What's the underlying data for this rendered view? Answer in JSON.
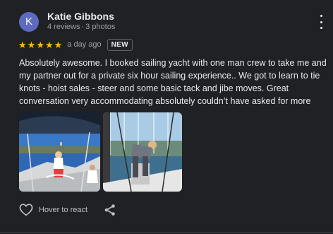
{
  "reviewer": {
    "initial": "K",
    "name": "Katie Gibbons",
    "reviews": "4 reviews",
    "photos": "3 photos",
    "separator": "·",
    "avatar_color": "#5c6bc0"
  },
  "rating": {
    "stars": 5,
    "star_glyph": "★",
    "star_color": "#fbbc04",
    "age": "a day ago",
    "badge": "NEW"
  },
  "review_text": "Absolutely awesome. I booked sailing yacht with one man crew to take me and my partner out for a private six hour sailing experience.. We got to learn to tie knots - hoist sales - steer and some basic tack and jibe moves. Great conversation very accommodating absolutely couldn’t have asked for more",
  "photos": [
    {
      "icon": "sailing-yacht-photo"
    },
    {
      "icon": "marina-deck-photo"
    }
  ],
  "actions": {
    "react_label": "Hover to react",
    "react_icon": "heart-outline-icon",
    "share_icon": "share-icon",
    "more_icon": "more-vert-icon"
  }
}
